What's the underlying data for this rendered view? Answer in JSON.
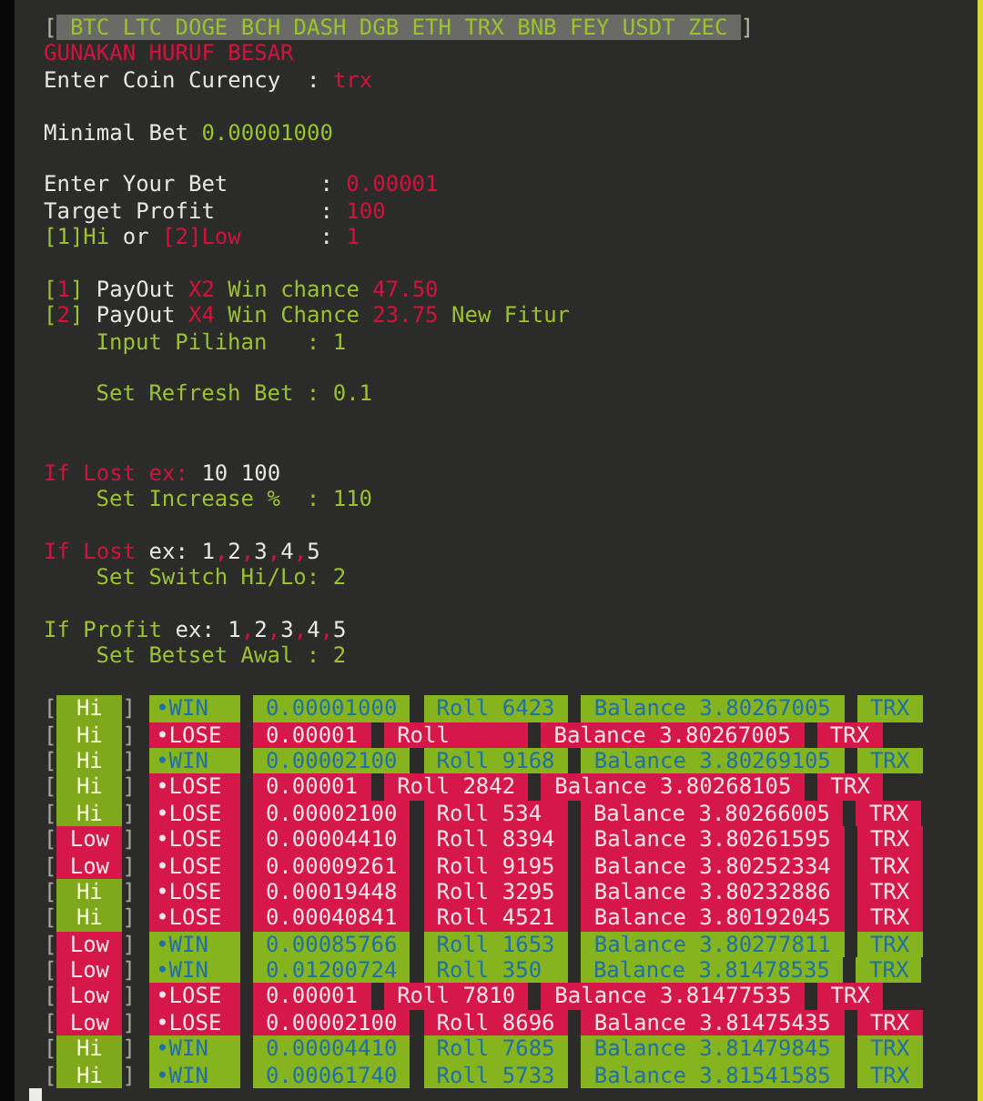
{
  "coin_bar": {
    "open": "[",
    "coins": " BTC LTC DOGE BCH DASH DGB ETH TRX BNB FEY USDT ZEC ",
    "close": "]"
  },
  "sections": [
    {
      "extra_gap": false,
      "lines": [
        {
          "indent": false,
          "segments": [
            {
              "text": "GUNAKAN HURUF BESAR",
              "color": "#d4123c"
            }
          ]
        },
        {
          "indent": false,
          "segments": [
            {
              "text": "Enter Coin Curency  : ",
              "color": "#e6e6e2"
            },
            {
              "text": "trx",
              "color": "#d4123c"
            }
          ]
        }
      ]
    },
    {
      "extra_gap": false,
      "lines": [
        {
          "indent": false,
          "segments": [
            {
              "text": "Minimal Bet ",
              "color": "#e6e6e2"
            },
            {
              "text": "0.00001000",
              "color": "#9cc22e"
            }
          ]
        }
      ]
    },
    {
      "extra_gap": false,
      "lines": [
        {
          "indent": false,
          "segments": [
            {
              "text": "Enter Your Bet       : ",
              "color": "#e6e6e2"
            },
            {
              "text": "0.00001",
              "color": "#d4123c"
            }
          ]
        },
        {
          "indent": false,
          "segments": [
            {
              "text": "Target Profit        : ",
              "color": "#e6e6e2"
            },
            {
              "text": "100",
              "color": "#d4123c"
            }
          ]
        },
        {
          "indent": false,
          "segments": [
            {
              "text": "[1]Hi",
              "color": "#9cc22e"
            },
            {
              "text": " or ",
              "color": "#e6e6e2"
            },
            {
              "text": "[2]Low",
              "color": "#d4123c"
            },
            {
              "text": "      : ",
              "color": "#e6e6e2"
            },
            {
              "text": "1",
              "color": "#d4123c"
            }
          ]
        }
      ]
    },
    {
      "extra_gap": false,
      "lines": [
        {
          "indent": false,
          "segments": [
            {
              "text": "[",
              "color": "#9cc22e"
            },
            {
              "text": "1",
              "color": "#d4123c"
            },
            {
              "text": "]",
              "color": "#9cc22e"
            },
            {
              "text": " PayOut ",
              "color": "#e6e6e2"
            },
            {
              "text": "X2",
              "color": "#d4123c"
            },
            {
              "text": " Win chance ",
              "color": "#9cc22e"
            },
            {
              "text": "47.50",
              "color": "#d4123c"
            }
          ]
        },
        {
          "indent": false,
          "segments": [
            {
              "text": "[",
              "color": "#9cc22e"
            },
            {
              "text": "2",
              "color": "#d4123c"
            },
            {
              "text": "]",
              "color": "#9cc22e"
            },
            {
              "text": " PayOut ",
              "color": "#e6e6e2"
            },
            {
              "text": "X4",
              "color": "#d4123c"
            },
            {
              "text": " Win Chance ",
              "color": "#9cc22e"
            },
            {
              "text": "23.75",
              "color": "#d4123c"
            },
            {
              "text": " New Fitur",
              "color": "#9cc22e"
            }
          ]
        },
        {
          "indent": true,
          "segments": [
            {
              "text": "Input Pilihan   : 1",
              "color": "#9cc22e"
            }
          ]
        }
      ]
    },
    {
      "extra_gap": false,
      "lines": [
        {
          "indent": true,
          "segments": [
            {
              "text": "Set Refresh Bet : 0.1",
              "color": "#9cc22e"
            }
          ]
        }
      ]
    },
    {
      "extra_gap": true,
      "lines": [
        {
          "indent": false,
          "segments": [
            {
              "text": "If Lost ex: ",
              "color": "#d4123c"
            },
            {
              "text": "10 100",
              "color": "#e6e6e2"
            }
          ]
        },
        {
          "indent": true,
          "segments": [
            {
              "text": "Set Increase %  : 110",
              "color": "#9cc22e"
            }
          ]
        }
      ]
    },
    {
      "extra_gap": false,
      "lines": [
        {
          "indent": false,
          "segments": [
            {
              "text": "If Lost",
              "color": "#d4123c"
            },
            {
              "text": " ex: 1",
              "color": "#e6e6e2"
            },
            {
              "text": ",",
              "color": "#d4123c"
            },
            {
              "text": "2",
              "color": "#e6e6e2"
            },
            {
              "text": ",",
              "color": "#d4123c"
            },
            {
              "text": "3",
              "color": "#e6e6e2"
            },
            {
              "text": ",",
              "color": "#d4123c"
            },
            {
              "text": "4",
              "color": "#e6e6e2"
            },
            {
              "text": ",",
              "color": "#d4123c"
            },
            {
              "text": "5",
              "color": "#e6e6e2"
            }
          ]
        },
        {
          "indent": true,
          "segments": [
            {
              "text": "Set Switch Hi/Lo: 2",
              "color": "#9cc22e"
            }
          ]
        }
      ]
    },
    {
      "extra_gap": false,
      "lines": [
        {
          "indent": false,
          "segments": [
            {
              "text": "If Profit",
              "color": "#9cc22e"
            },
            {
              "text": " ex: 1",
              "color": "#e6e6e2"
            },
            {
              "text": ",",
              "color": "#d4123c"
            },
            {
              "text": "2",
              "color": "#e6e6e2"
            },
            {
              "text": ",",
              "color": "#d4123c"
            },
            {
              "text": "3",
              "color": "#e6e6e2"
            },
            {
              "text": ",",
              "color": "#d4123c"
            },
            {
              "text": "4",
              "color": "#e6e6e2"
            },
            {
              "text": ",",
              "color": "#d4123c"
            },
            {
              "text": "5",
              "color": "#e6e6e2"
            }
          ]
        },
        {
          "indent": true,
          "segments": [
            {
              "text": "Set Betset Awal : 2",
              "color": "#9cc22e"
            }
          ]
        }
      ]
    }
  ],
  "bets": [
    {
      "open": "[",
      "side": "Hi",
      "hi": true,
      "close": "]",
      "result": "•WIN",
      "win": true,
      "amount": "0.00001000",
      "roll": "Roll 6423",
      "balance": "Balance 3.80267005",
      "unit": "TRX"
    },
    {
      "open": "[",
      "side": "Hi",
      "hi": true,
      "close": "]",
      "result": "•LOSE",
      "win": false,
      "amount": "0.00001",
      "roll": "Roll",
      "balance": "Balance 3.80267005",
      "unit": "TRX"
    },
    {
      "open": "[",
      "side": "Hi",
      "hi": true,
      "close": "]",
      "result": "•WIN",
      "win": true,
      "amount": "0.00002100",
      "roll": "Roll 9168",
      "balance": "Balance 3.80269105",
      "unit": "TRX"
    },
    {
      "open": "[",
      "side": "Hi",
      "hi": true,
      "close": "]",
      "result": "•LOSE",
      "win": false,
      "amount": "0.00001",
      "roll": "Roll 2842",
      "balance": "Balance 3.80268105",
      "unit": "TRX"
    },
    {
      "open": "[",
      "side": "Hi",
      "hi": true,
      "close": "]",
      "result": "•LOSE",
      "win": false,
      "amount": "0.00002100",
      "roll": "Roll 534",
      "balance": "Balance 3.80266005",
      "unit": "TRX"
    },
    {
      "open": "[",
      "side": "Low",
      "hi": false,
      "close": "]",
      "result": "•LOSE",
      "win": false,
      "amount": "0.00004410",
      "roll": "Roll 8394",
      "balance": "Balance 3.80261595",
      "unit": "TRX"
    },
    {
      "open": "[",
      "side": "Low",
      "hi": false,
      "close": "]",
      "result": "•LOSE",
      "win": false,
      "amount": "0.00009261",
      "roll": "Roll 9195",
      "balance": "Balance 3.80252334",
      "unit": "TRX"
    },
    {
      "open": "[",
      "side": "Hi",
      "hi": true,
      "close": "]",
      "result": "•LOSE",
      "win": false,
      "amount": "0.00019448",
      "roll": "Roll 3295",
      "balance": "Balance 3.80232886",
      "unit": "TRX"
    },
    {
      "open": "[",
      "side": "Hi",
      "hi": true,
      "close": "]",
      "result": "•LOSE",
      "win": false,
      "amount": "0.00040841",
      "roll": "Roll 4521",
      "balance": "Balance 3.80192045",
      "unit": "TRX"
    },
    {
      "open": "[",
      "side": "Low",
      "hi": false,
      "close": "]",
      "result": "•WIN",
      "win": true,
      "amount": "0.00085766",
      "roll": "Roll 1653",
      "balance": "Balance 3.80277811",
      "unit": "TRX"
    },
    {
      "open": "[",
      "side": "Low",
      "hi": false,
      "close": "]",
      "result": "•WIN",
      "win": true,
      "amount": "0.01200724",
      "roll": "Roll 350",
      "balance": "Balance 3.81478535",
      "unit": "TRX"
    },
    {
      "open": "[",
      "side": "Low",
      "hi": false,
      "close": "]",
      "result": "•LOSE",
      "win": false,
      "amount": "0.00001",
      "roll": "Roll 7810",
      "balance": "Balance 3.81477535",
      "unit": "TRX"
    },
    {
      "open": "[",
      "side": "Low",
      "hi": false,
      "close": "]",
      "result": "•LOSE",
      "win": false,
      "amount": "0.00002100",
      "roll": "Roll 8696",
      "balance": "Balance 3.81475435",
      "unit": "TRX"
    },
    {
      "open": "[",
      "side": "Hi",
      "hi": true,
      "close": "]",
      "result": "•WIN",
      "win": true,
      "amount": "0.00004410",
      "roll": "Roll 7685",
      "balance": "Balance 3.81479845",
      "unit": "TRX"
    },
    {
      "open": "[",
      "side": "Hi",
      "hi": true,
      "close": "]",
      "result": "•WIN",
      "win": true,
      "amount": "0.00061740",
      "roll": "Roll 5733",
      "balance": "Balance 3.81541585",
      "unit": "TRX"
    }
  ]
}
